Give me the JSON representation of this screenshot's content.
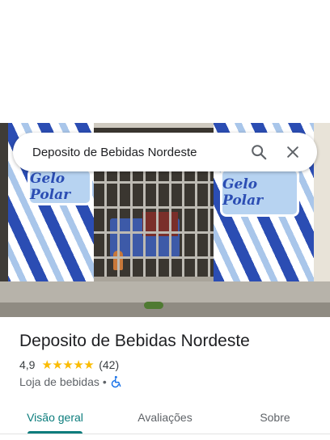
{
  "search": {
    "query": "Deposito de Bebidas Nordeste",
    "search_icon": "search-icon",
    "close_icon": "close-icon"
  },
  "photo": {
    "sign_left": "Gelo Polar",
    "sign_right": "Gelo Polar"
  },
  "place": {
    "name": "Deposito de Bebidas Nordeste",
    "rating": "4,9",
    "stars": 5,
    "review_count": "(42)",
    "category": "Loja de bebidas",
    "separator": "•",
    "accessibility_icon": "wheelchair-icon"
  },
  "tabs": [
    {
      "label": "Visão geral",
      "active": true
    },
    {
      "label": "Avaliações",
      "active": false
    },
    {
      "label": "Sobre",
      "active": false
    }
  ],
  "colors": {
    "accent": "#0b7c7c",
    "star": "#fbbc04",
    "accessibility": "#1a73e8"
  }
}
